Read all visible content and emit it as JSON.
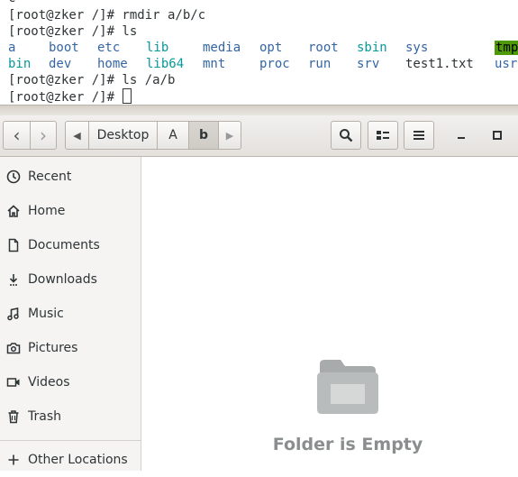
{
  "terminal": {
    "top_partial": "c",
    "lines": [
      "[root@zker /]# rmdir a/b/c",
      "[root@zker /]# ls",
      "[root@zker /]# ls /a/b",
      "[root@zker /]# "
    ],
    "ls_row1": [
      {
        "name": "a",
        "type": "dir"
      },
      {
        "name": "boot",
        "type": "dir"
      },
      {
        "name": "etc",
        "type": "dir"
      },
      {
        "name": "lib",
        "type": "link"
      },
      {
        "name": "media",
        "type": "dir"
      },
      {
        "name": "opt",
        "type": "dir"
      },
      {
        "name": "root",
        "type": "dir"
      },
      {
        "name": "sbin",
        "type": "link"
      },
      {
        "name": "sys",
        "type": "dir"
      },
      {
        "name": "tmp",
        "type": "sticky"
      }
    ],
    "ls_row2": [
      {
        "name": "bin",
        "type": "link"
      },
      {
        "name": "dev",
        "type": "dir"
      },
      {
        "name": "home",
        "type": "dir"
      },
      {
        "name": "lib64",
        "type": "link"
      },
      {
        "name": "mnt",
        "type": "dir"
      },
      {
        "name": "proc",
        "type": "dir"
      },
      {
        "name": "run",
        "type": "dir"
      },
      {
        "name": "srv",
        "type": "dir"
      },
      {
        "name": "test1.txt",
        "type": "file"
      },
      {
        "name": "usr",
        "type": "dir"
      }
    ]
  },
  "file_manager": {
    "pathbar": [
      "Desktop",
      "A",
      "b"
    ],
    "sidebar": [
      {
        "label": "Recent",
        "icon": "clock-icon"
      },
      {
        "label": "Home",
        "icon": "home-icon"
      },
      {
        "label": "Documents",
        "icon": "document-icon"
      },
      {
        "label": "Downloads",
        "icon": "download-icon"
      },
      {
        "label": "Music",
        "icon": "music-icon"
      },
      {
        "label": "Pictures",
        "icon": "camera-icon"
      },
      {
        "label": "Videos",
        "icon": "video-icon"
      },
      {
        "label": "Trash",
        "icon": "trash-icon"
      }
    ],
    "other_locations": "Other Locations",
    "empty_message": "Folder is Empty"
  }
}
